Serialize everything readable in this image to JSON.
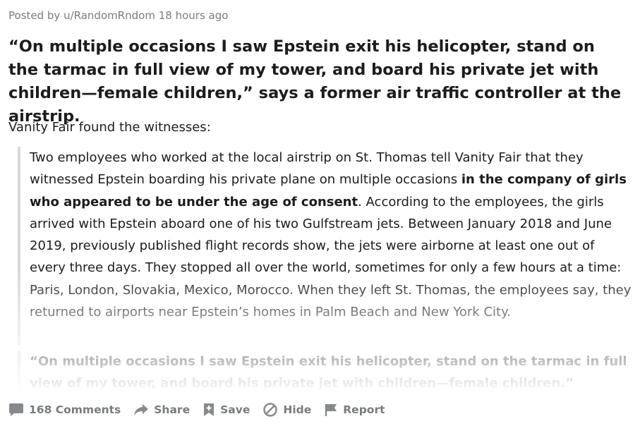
{
  "post": {
    "byline": "Posted by u/RandomRndom 18 hours ago",
    "title": "“On multiple occasions I saw Epstein exit his helicopter, stand on the tarmac in full view of my tower, and board his private jet with children—female children,” says a former air traffic controller at the airstrip.",
    "intro": "Vanity Fair found the witnesses:",
    "quote1": {
      "part1": "Two employees who worked at the local airstrip on St. Thomas tell Vanity Fair that they witnessed Epstein boarding his private plane on multiple occasions ",
      "bold": "in the company of girls who appeared to be under the age of consent",
      "part2": ". According to the employees, the girls arrived with Epstein aboard one of his two Gulfstream jets. Between January 2018 and June 2019, previously published flight records show, the jets were airborne at least one out of every three days. They stopped all over the world, sometimes for only a few hours at a time: Paris, London, Slovakia, Mexico, Morocco. When they left St. Thomas, the employees say, they returned to airports near Epstein’s homes in Palm Beach and New York City."
    },
    "quote2": "“On multiple occasions I saw Epstein exit his helicopter, stand on the tarmac in full view of my tower, and board his private jet with children—female children.”"
  },
  "actions": {
    "comments": {
      "label": "168 Comments",
      "icon": "comment-icon"
    },
    "share": {
      "label": "Share",
      "icon": "share-icon"
    },
    "save": {
      "label": "Save",
      "icon": "save-icon"
    },
    "hide": {
      "label": "Hide",
      "icon": "hide-icon"
    },
    "report": {
      "label": "Report",
      "icon": "report-icon"
    }
  },
  "colors": {
    "meta": "#787c7e",
    "text": "#1c1c1c",
    "quote_border": "#d7d9da",
    "icon": "#878a8c"
  }
}
